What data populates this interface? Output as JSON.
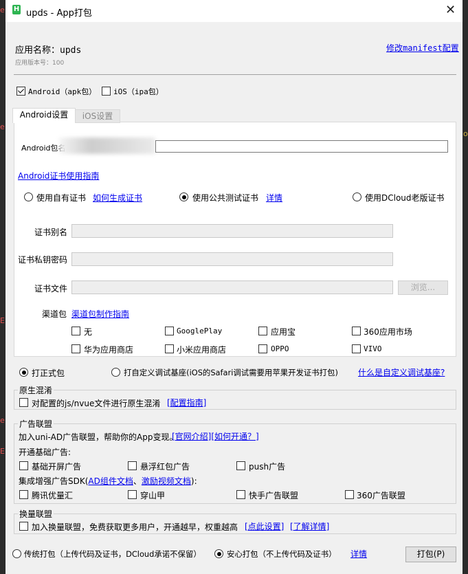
{
  "window": {
    "title": "upds - App打包",
    "icon_letter": "H"
  },
  "header": {
    "app_name_label": "应用名称：",
    "app_name": "upds",
    "version_label": "应用版本号：",
    "version": "100",
    "manifest_link": "修改manifest配置"
  },
  "platforms": {
    "android": {
      "label": "Android（apk包）",
      "checked": true
    },
    "ios": {
      "label": "iOS（ipa包）",
      "checked": false
    }
  },
  "tabs": [
    {
      "label": "Android设置",
      "active": true
    },
    {
      "label": "iOS设置",
      "active": false
    }
  ],
  "android": {
    "package_label": "Android包名",
    "package_value": "",
    "cert_guide_link": "Android证书使用指南",
    "cert_options": [
      {
        "label": "使用自有证书",
        "checked": false
      },
      {
        "label": "使用公共测试证书",
        "checked": true
      },
      {
        "label": "使用DCloud老版证书",
        "checked": false
      }
    ],
    "how_to_generate_link": "如何生成证书",
    "details_link": "详情",
    "alias_label": "证书别名",
    "password_label": "证书私钥密码",
    "file_label": "证书文件",
    "browse_button": "浏览...",
    "channel_label": "渠道包",
    "channel_guide_link": "渠道包制作指南",
    "channels": [
      {
        "label": "无",
        "checked": false
      },
      {
        "label": "GooglePlay",
        "checked": false
      },
      {
        "label": "应用宝",
        "checked": false
      },
      {
        "label": "360应用市场",
        "checked": false
      },
      {
        "label": "华为应用商店",
        "checked": false
      },
      {
        "label": "小米应用商店",
        "checked": false
      },
      {
        "label": "OPPO",
        "checked": false
      },
      {
        "label": "VIVO",
        "checked": false
      }
    ]
  },
  "build_type": {
    "formal": {
      "label": "打正式包",
      "checked": true
    },
    "custom": {
      "label": "打自定义调试基座(iOS的Safari调试需要用苹果开发证书打包)",
      "checked": false
    },
    "custom_link": "什么是自定义调试基座?"
  },
  "obfuscation": {
    "title": "原生混淆",
    "label": "对配置的js/nvue文件进行原生混淆",
    "link": "[配置指南]"
  },
  "ads": {
    "title": "广告联盟",
    "intro": "加入uni-AD广告联盟，帮助你的App变现。",
    "intro_link": "[官网介绍][如何开通？]",
    "basic_label": "开通基础广告:",
    "basic": [
      {
        "label": "基础开屏广告",
        "checked": false
      },
      {
        "label": "悬浮红包广告",
        "checked": false
      },
      {
        "label": "push广告",
        "checked": false
      }
    ],
    "sdk_label_prefix": "集成增强广告SDK(",
    "sdk_link1": "AD组件文档",
    "sdk_sep": "、",
    "sdk_link2": "激励视频文档",
    "sdk_label_suffix": "):",
    "sdk": [
      {
        "label": "腾讯优量汇",
        "checked": false
      },
      {
        "label": "穿山甲",
        "checked": false
      },
      {
        "label": "快手广告联盟",
        "checked": false
      },
      {
        "label": "360广告联盟",
        "checked": false
      }
    ]
  },
  "exchange": {
    "title": "换量联盟",
    "label": "加入换量联盟，免费获取更多用户，开通越早，权重越高",
    "link1": "[点此设置]",
    "link2": "[了解详情]"
  },
  "footer": {
    "traditional": {
      "label": "传统打包（上传代码及证书，DCloud承诺不保留）",
      "checked": false
    },
    "secure": {
      "label": "安心打包（不上传代码及证书）",
      "checked": true
    },
    "details_link": "详情",
    "pack_button": "打包(P)"
  }
}
